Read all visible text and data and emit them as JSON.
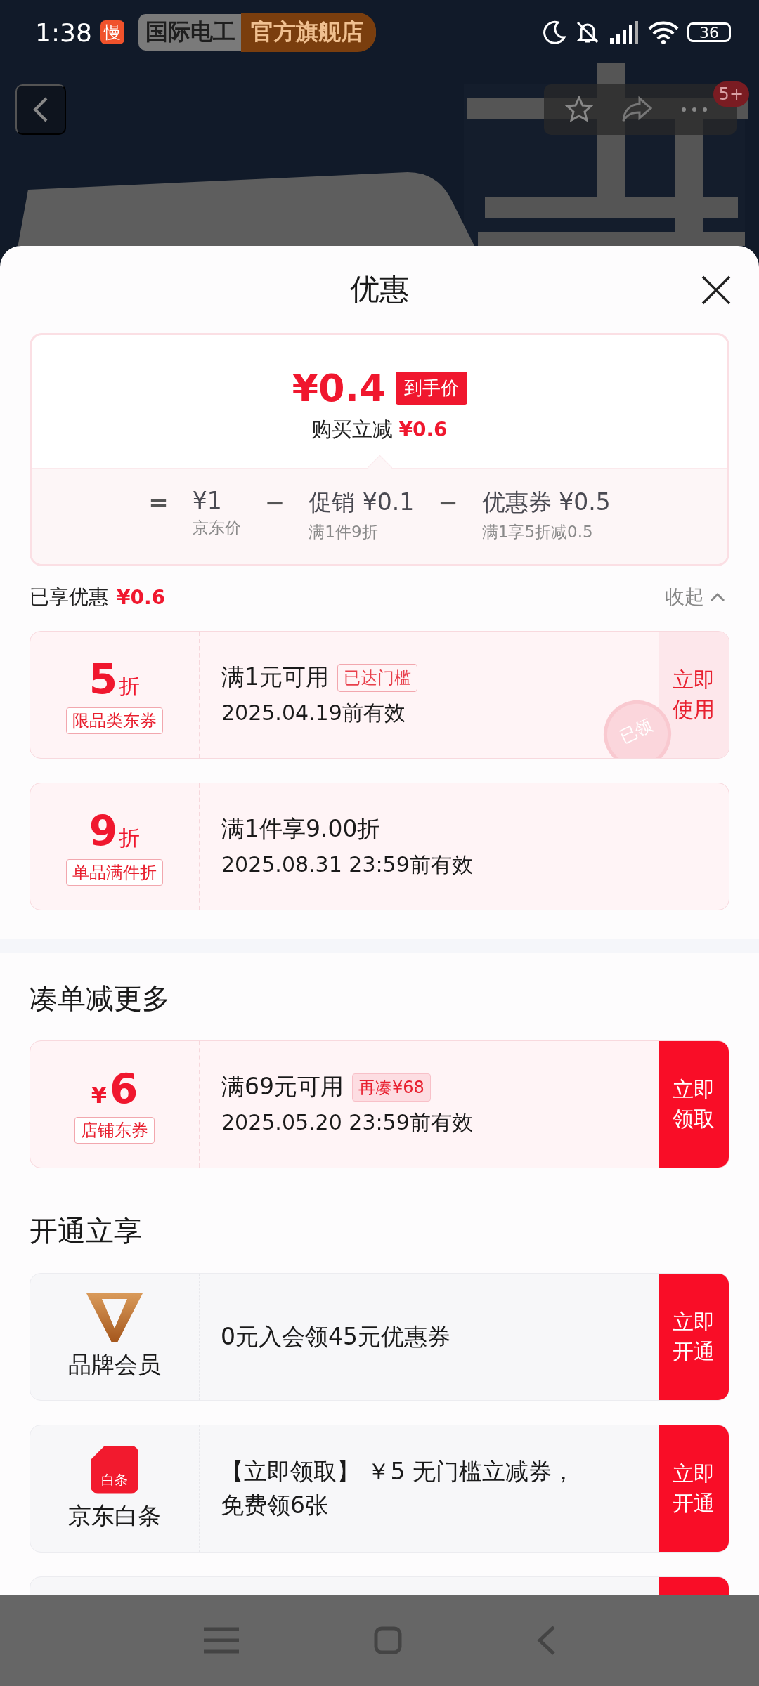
{
  "status_bar": {
    "time": "1:38",
    "app_badge": "慢",
    "battery": "36"
  },
  "header": {
    "store_name": "国际电工",
    "store_tag": "官方旗舰店",
    "notification_count": "5+"
  },
  "sheet": {
    "title": "优惠"
  },
  "price": {
    "amount": "¥0.4",
    "tag": "到手价",
    "saving_label": "购买立减",
    "saving": "¥0.6",
    "breakdown": [
      {
        "operator": "=",
        "value": "¥1",
        "note": "京东价"
      },
      {
        "operator": "−",
        "label": "促销",
        "value": "¥0.1",
        "note": "满1件9折"
      },
      {
        "operator": "−",
        "label": "优惠券",
        "value": "¥0.5",
        "note": "满1享5折减0.5"
      }
    ]
  },
  "enjoyed": {
    "label": "已享优惠",
    "amount": "¥0.6",
    "collapse": "收起"
  },
  "coupons": [
    {
      "kind": "discount",
      "value": "5",
      "unit": "折",
      "tag": "限品类东券",
      "title": "满1元可用",
      "badge": {
        "text": "已达门槛",
        "kind": "reached"
      },
      "validity": "2025.04.19前有效",
      "action": {
        "text": "立即使用",
        "kind": "use"
      },
      "stamp": "已领"
    },
    {
      "kind": "discount",
      "value": "9",
      "unit": "折",
      "tag": "单品满件折",
      "title": "满1件享9.00折",
      "validity": "2025.08.31 23:59前有效"
    }
  ],
  "more_section": {
    "title": "凑单减更多",
    "coupons": [
      {
        "kind": "cash",
        "value": "6",
        "unit": "¥",
        "tag": "店铺东券",
        "title": "满69元可用",
        "badge": {
          "text": "再凑¥68",
          "kind": "gap"
        },
        "validity": "2025.05.20 23:59前有效",
        "action": {
          "text": "立即领取",
          "kind": "claim"
        }
      }
    ]
  },
  "open_section": {
    "title": "开通立享",
    "benefits": [
      {
        "kind": "brand",
        "name": "品牌会员",
        "text": "0元入会领45元优惠券",
        "action": "立即开通"
      },
      {
        "kind": "credit",
        "icon_label": "白条",
        "name": "京东白条",
        "text": "【立即领取】 ￥5 无门槛立减券，免费领6张",
        "action": "立即开通"
      }
    ]
  }
}
